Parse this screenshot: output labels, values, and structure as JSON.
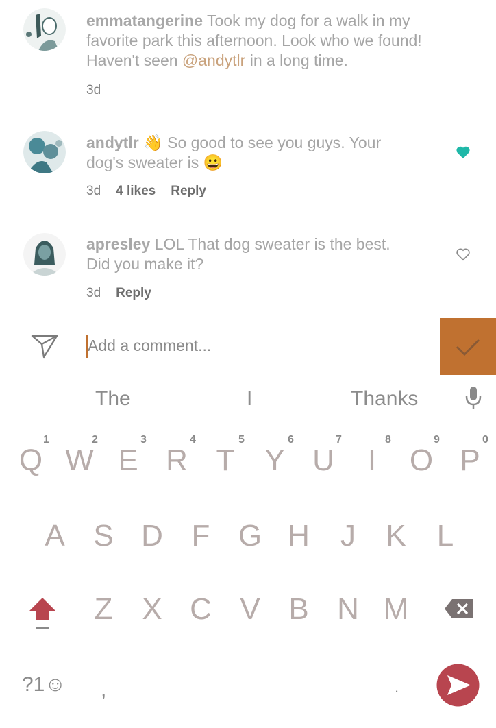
{
  "comments": [
    {
      "username": "emmatangerine",
      "text_before": " Took my dog for a walk in my favorite park this afternoon. Look who we found! Haven't seen ",
      "mention": "@andytlr",
      "text_after": " in a long time.",
      "time": "3d"
    },
    {
      "username": "andytlr",
      "emoji1": "👋",
      "text": " So good to see you guys. Your dog's sweater is ",
      "emoji2": "😀",
      "time": "3d",
      "likes": "4 likes",
      "reply": "Reply",
      "liked": true
    },
    {
      "username": "apresley",
      "text": " LOL That dog sweater is the best. Did you make it?",
      "time": "3d",
      "reply": "Reply",
      "liked": false
    }
  ],
  "composer": {
    "placeholder": "Add a comment..."
  },
  "keyboard": {
    "suggestions": [
      "The",
      "I",
      "Thanks"
    ],
    "row1": [
      "Q",
      "W",
      "E",
      "R",
      "T",
      "Y",
      "U",
      "I",
      "O",
      "P"
    ],
    "row1_hints": [
      "1",
      "2",
      "3",
      "4",
      "5",
      "6",
      "7",
      "8",
      "9",
      "0"
    ],
    "row2": [
      "A",
      "S",
      "D",
      "F",
      "G",
      "H",
      "J",
      "K",
      "L"
    ],
    "row3": [
      "Z",
      "X",
      "C",
      "V",
      "B",
      "N",
      "M"
    ],
    "symbols_key": "?1☺",
    "comma": ",",
    "period": "."
  },
  "colors": {
    "accent": "#c07130",
    "like": "#1fb8a8",
    "shift": "#b8454f",
    "send": "#b8454f"
  }
}
